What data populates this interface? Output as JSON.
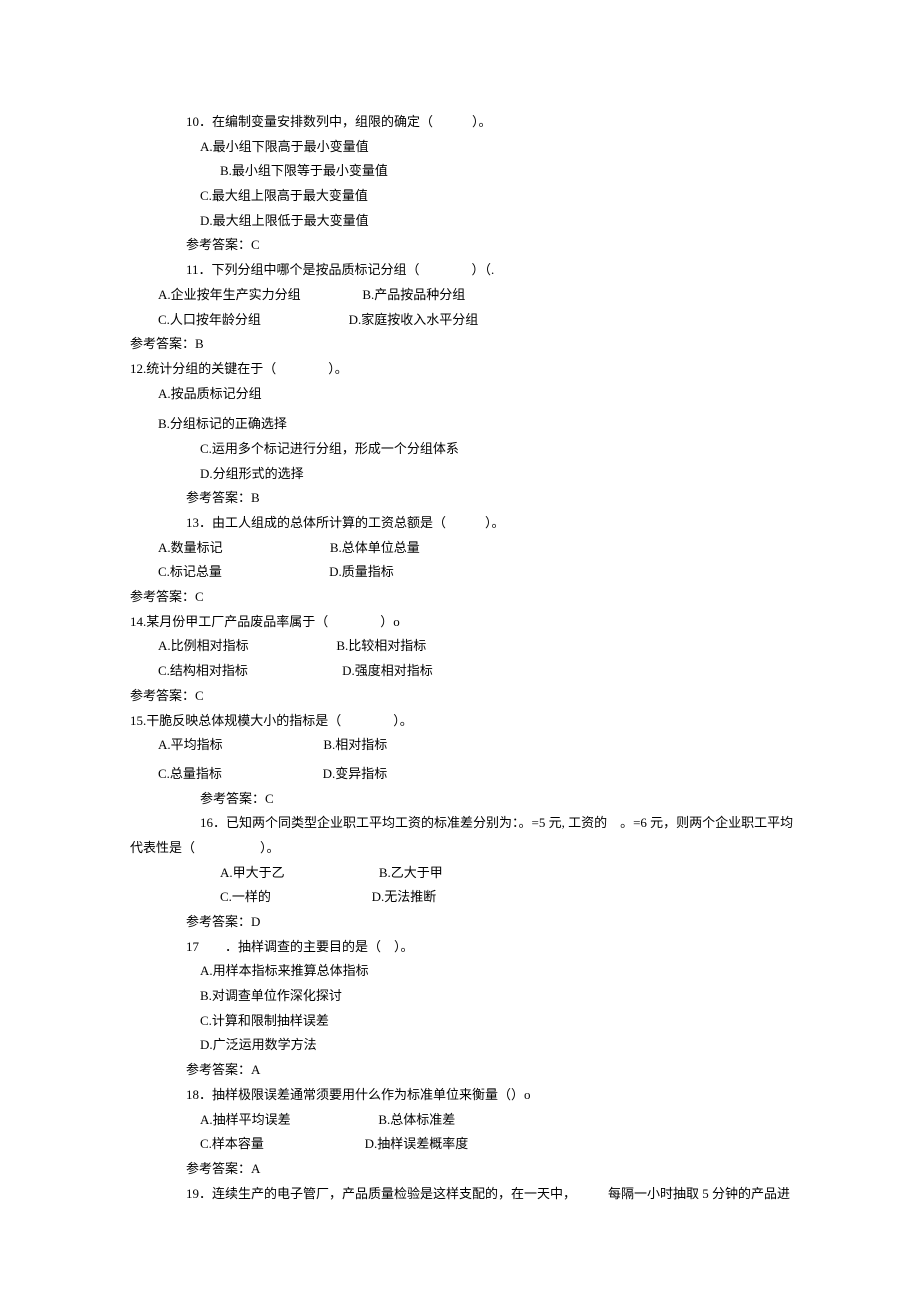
{
  "q10": {
    "num": "10",
    "stem": "．在编制变量安排数列中，组限的确定（　　　）。",
    "a": "A.最小组下限高于最小变量值",
    "b": "B.最小组下限等于最小变量值",
    "c": "C.最大组上限高于最大变量值",
    "d": "D.最大组上限低于最大变量值",
    "ans": "参考答案：C"
  },
  "q11": {
    "num": "11",
    "stem": "．下列分组中哪个是按品质标记分组（　　　　）（.",
    "a": "A.企业按年生产实力分组",
    "b": "B.产品按品种分组",
    "c": "C.人口按年龄分组",
    "d": "D.家庭按收入水平分组",
    "ans": "参考答案：B"
  },
  "q12": {
    "stem": "12.统计分组的关键在于（　　　　）。",
    "a": "A.按品质标记分组",
    "b": "B.分组标记的正确选择",
    "c": "C.运用多个标记进行分组，形成一个分组体系",
    "d": "D.分组形式的选择",
    "ans": "参考答案：B"
  },
  "q13": {
    "num": "13",
    "stem": "．由工人组成的总体所计算的工资总额是（　　　）。",
    "a": "A.数量标记",
    "b": "B.总体单位总量",
    "c": "C.标记总量",
    "d": "D.质量指标",
    "ans": "参考答案：C"
  },
  "q14": {
    "stem": "14.某月份甲工厂产品废品率属于（　　　　）o",
    "a": "A.比例相对指标",
    "b": "B.比较相对指标",
    "c": "C.结构相对指标",
    "d": "D.强度相对指标",
    "ans": "参考答案：C"
  },
  "q15": {
    "stem": "15.干脆反映总体规模大小的指标是（　　　　）。",
    "a": "A.平均指标",
    "b": "B.相对指标",
    "c": "C.总量指标",
    "d": "D.变异指标",
    "ans": "参考答案：C"
  },
  "q16": {
    "num": "16",
    "stem1": "．已知两个同类型企业职工平均工资的标准差分别为：。=5 元, 工资的　。=6 元，则两个企业职工平均",
    "stem2": "代表性是（　　　　　）。",
    "a": "A.甲大于乙",
    "b": "B.乙大于甲",
    "c": "C.一样的",
    "d": "D.无法推断",
    "ans": "参考答案：D"
  },
  "q17": {
    "num": "17",
    "stem": "　　．抽样调查的主要目的是（　）。",
    "a": "A.用样本指标来推算总体指标",
    "b": "B.对调查单位作深化探讨",
    "c": "C.计算和限制抽样误差",
    "d": "D.广泛运用数学方法",
    "ans": "参考答案：A"
  },
  "q18": {
    "num": "18",
    "stem": "．抽样极限误差通常须要用什么作为标准单位来衡量（）o",
    "a": "A.抽样平均误差",
    "b": "B.总体标准差",
    "c": "C.样本容量",
    "d": "D.抽样误差概率度",
    "ans": "参考答案：A"
  },
  "q19": {
    "num": "19",
    "stem": "．连续生产的电子管厂，产品质量检验是这样支配的，在一天中，",
    "right": "每隔一小时抽取 5 分钟的产品进"
  }
}
